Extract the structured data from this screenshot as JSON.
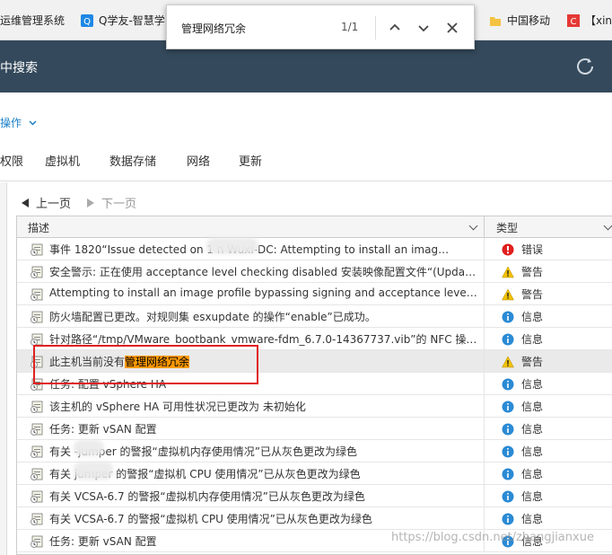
{
  "bookmarks": [
    {
      "label": "运维管理系统",
      "icon": "page-icon"
    },
    {
      "label": "Q学友-智慧学",
      "icon": "qxueyou-icon"
    },
    {
      "label": "中国移动",
      "icon": "folder-icon"
    },
    {
      "label": "【xin",
      "icon": "c-icon"
    }
  ],
  "header": {
    "title": "中搜索"
  },
  "actions": {
    "label": "操作"
  },
  "tabs": [
    "权限",
    "虚拟机",
    "数据存储",
    "网络",
    "更新"
  ],
  "pager": {
    "prev": "上一页",
    "next": "下一页"
  },
  "grid": {
    "columns": {
      "desc": "描述",
      "type": "类型"
    },
    "rows": [
      {
        "desc": "事件 1820“Issue detected on 1          n Wuxi-DC: Attempting to install an imag…",
        "type": "错误",
        "kind": "error"
      },
      {
        "desc": "安全警示: 正在使用 acceptance level checking disabled 安装映像配置文件“(Upda…",
        "type": "警告",
        "kind": "warn"
      },
      {
        "desc": "Attempting to install an image profile bypassing signing and acceptance level veri…",
        "type": "警告",
        "kind": "warn"
      },
      {
        "desc": "防火墙配置已更改。对规则集 esxupdate 的操作“enable”已成功。",
        "type": "信息",
        "kind": "info"
      },
      {
        "desc": "针对路径“/tmp/VMware_bootbank_vmware-fdm_6.7.0-14367737.vib”的 NFC 操作“…",
        "type": "信息",
        "kind": "info"
      },
      {
        "desc_prefix": "此主机当前没有",
        "desc_highlight": "管理网络冗余",
        "type": "警告",
        "kind": "warn",
        "selected": true
      },
      {
        "desc": "任务: 配置 vSphere HA",
        "type": "信息",
        "kind": "info"
      },
      {
        "desc": "该主机的 vSphere HA 可用性状况已更改为 未初始化",
        "type": "信息",
        "kind": "info"
      },
      {
        "desc": "任务: 更新 vSAN 配置",
        "type": "信息",
        "kind": "info"
      },
      {
        "desc": "有关       -jumper 的警报“虚拟机内存使用情况”已从灰色更改为绿色",
        "type": "信息",
        "kind": "info"
      },
      {
        "desc": "有关        jumper 的警报“虚拟机 CPU 使用情况”已从灰色更改为绿色",
        "type": "信息",
        "kind": "info"
      },
      {
        "desc": "有关 VCSA-6.7 的警报“虚拟机内存使用情况”已从灰色更改为绿色",
        "type": "信息",
        "kind": "info"
      },
      {
        "desc": "有关 VCSA-6.7 的警报“虚拟机 CPU 使用情况”已从灰色更改为绿色",
        "type": "信息",
        "kind": "info"
      },
      {
        "desc": "任务: 更新 vSAN 配置",
        "type": "信息",
        "kind": "info"
      }
    ]
  },
  "findbar": {
    "query": "管理网络冗余",
    "count": "1/1"
  },
  "watermark": "https://blog.csdn.net/zhangjianxue",
  "colors": {
    "header_bg": "#34495b",
    "highlight": "#ff9900",
    "annotation": "#e02020",
    "info": "#2a8ad4",
    "warn": "#f2c200",
    "error": "#e01e1e"
  }
}
